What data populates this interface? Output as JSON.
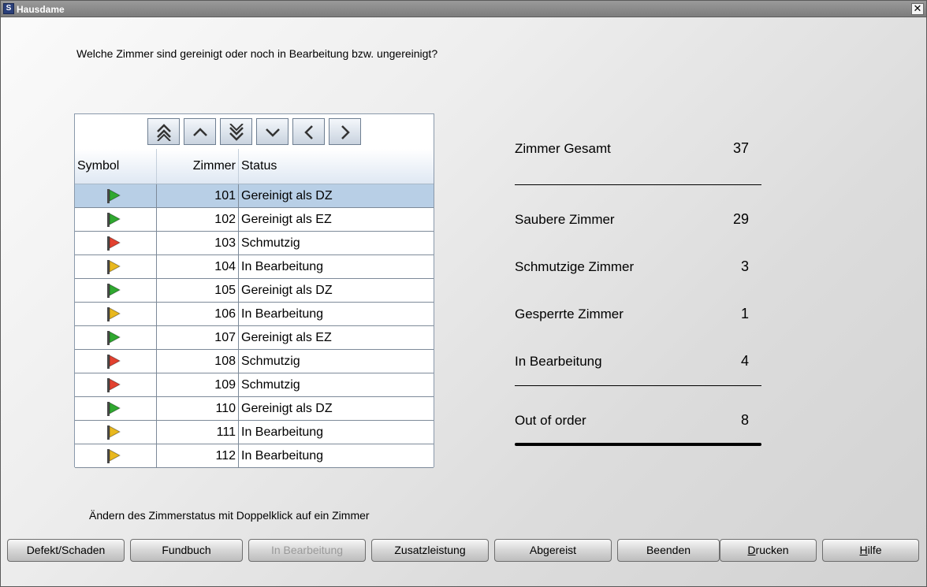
{
  "window": {
    "title": "Hausdame",
    "icon": "app-icon",
    "close_symbol": "✕"
  },
  "question": "Welche Zimmer sind gereinigt oder noch in Bearbeitung bzw. ungereinigt?",
  "nav_buttons": [
    "first-page-icon",
    "up-icon",
    "last-page-icon",
    "down-icon",
    "left-icon",
    "right-icon"
  ],
  "table": {
    "headers": {
      "symbol": "Symbol",
      "zimmer": "Zimmer",
      "status": "Status"
    },
    "rows": [
      {
        "flag": "green",
        "zimmer": "101",
        "status": "Gereinigt als DZ",
        "selected": true
      },
      {
        "flag": "green",
        "zimmer": "102",
        "status": "Gereinigt als EZ"
      },
      {
        "flag": "red",
        "zimmer": "103",
        "status": "Schmutzig"
      },
      {
        "flag": "yellow",
        "zimmer": "104",
        "status": "In Bearbeitung"
      },
      {
        "flag": "green",
        "zimmer": "105",
        "status": "Gereinigt als DZ"
      },
      {
        "flag": "yellow",
        "zimmer": "106",
        "status": "In Bearbeitung"
      },
      {
        "flag": "green",
        "zimmer": "107",
        "status": "Gereinigt als EZ"
      },
      {
        "flag": "red",
        "zimmer": "108",
        "status": "Schmutzig"
      },
      {
        "flag": "red",
        "zimmer": "109",
        "status": "Schmutzig"
      },
      {
        "flag": "green",
        "zimmer": "110",
        "status": "Gereinigt als DZ"
      },
      {
        "flag": "yellow",
        "zimmer": "111",
        "status": "In Bearbeitung"
      },
      {
        "flag": "yellow",
        "zimmer": "112",
        "status": "In Bearbeitung"
      }
    ]
  },
  "flag_colors": {
    "green": "#2fa82f",
    "red": "#e2412f",
    "yellow": "#e8b81e"
  },
  "stats": {
    "gesamt": {
      "label": "Zimmer Gesamt",
      "value": "37"
    },
    "sauber": {
      "label": "Saubere Zimmer",
      "value": "29"
    },
    "schmutzig": {
      "label": "Schmutzige Zimmer",
      "value": "3"
    },
    "gesperrt": {
      "label": "Gesperrte Zimmer",
      "value": "1"
    },
    "bearbeitung": {
      "label": "In Bearbeitung",
      "value": "4"
    },
    "outoforder": {
      "label": "Out of order",
      "value": "8"
    }
  },
  "hint": "Ändern des Zimmerstatus mit Doppelklick auf ein Zimmer",
  "buttons": {
    "defekt": "Defekt/Schaden",
    "fundbuch": "Fundbuch",
    "bearbeitung": "In Bearbeitung",
    "zusatz": "Zusatzleistung",
    "abgereist": "Abgereist",
    "beenden": "Beenden",
    "drucken_mnemonic": "D",
    "drucken_rest": "rucken",
    "hilfe_mnemonic": "H",
    "hilfe_rest": "ilfe"
  }
}
